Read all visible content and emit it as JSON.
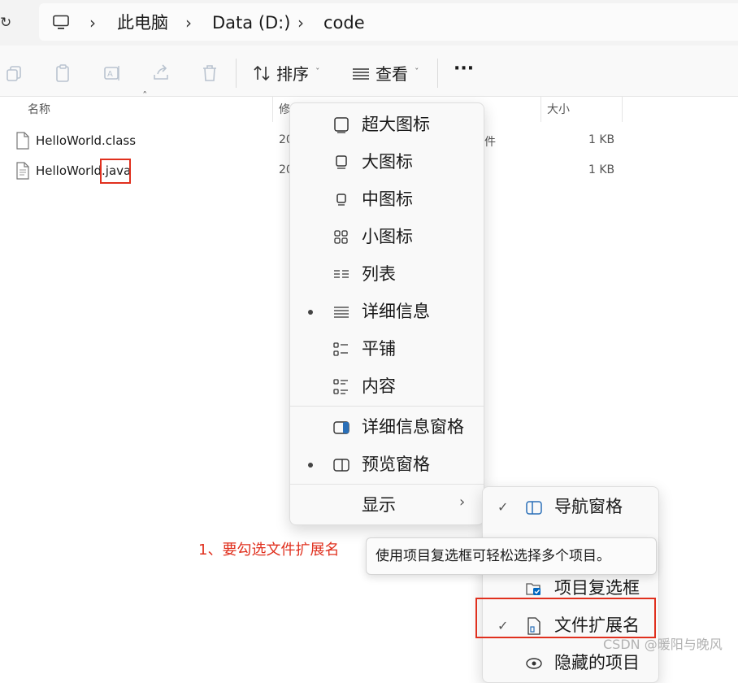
{
  "address_bar": {
    "crumbs": [
      "此电脑",
      "Data (D:)",
      "code"
    ]
  },
  "toolbar": {
    "sort_label": "排序",
    "view_label": "查看",
    "more_label": "···"
  },
  "file_list": {
    "headers": {
      "name": "名称",
      "modified": "修",
      "size": "大小"
    },
    "type_fragment": "件",
    "files": [
      {
        "name": "HelloWorld.class",
        "date": "20",
        "size": "1 KB"
      },
      {
        "name": "HelloWorld.java",
        "date": "20",
        "size": "1 KB"
      }
    ]
  },
  "view_menu": {
    "items": [
      {
        "label": "超大图标",
        "selected": false
      },
      {
        "label": "大图标",
        "selected": false
      },
      {
        "label": "中图标",
        "selected": false
      },
      {
        "label": "小图标",
        "selected": false
      },
      {
        "label": "列表",
        "selected": false
      },
      {
        "label": "详细信息",
        "selected": true
      },
      {
        "label": "平铺",
        "selected": false
      },
      {
        "label": "内容",
        "selected": false
      },
      {
        "label": "详细信息窗格",
        "selected": false
      },
      {
        "label": "预览窗格",
        "selected": true
      },
      {
        "label": "显示",
        "selected": false
      }
    ]
  },
  "show_submenu": {
    "items": [
      {
        "label": "导航窗格",
        "checked": true
      },
      {
        "label": "项目复选框",
        "checked": false
      },
      {
        "label": "文件扩展名",
        "checked": true
      },
      {
        "label": "隐藏的项目",
        "checked": false
      }
    ]
  },
  "tooltip": {
    "text": "使用项目复选框可轻松选择多个项目。"
  },
  "annotation": {
    "text": "1、要勾选文件扩展名"
  },
  "watermark": {
    "text": "CSDN @暖阳与晚风"
  },
  "colors": {
    "accent": "#0067c0",
    "annotation_red": "#e0301e"
  }
}
